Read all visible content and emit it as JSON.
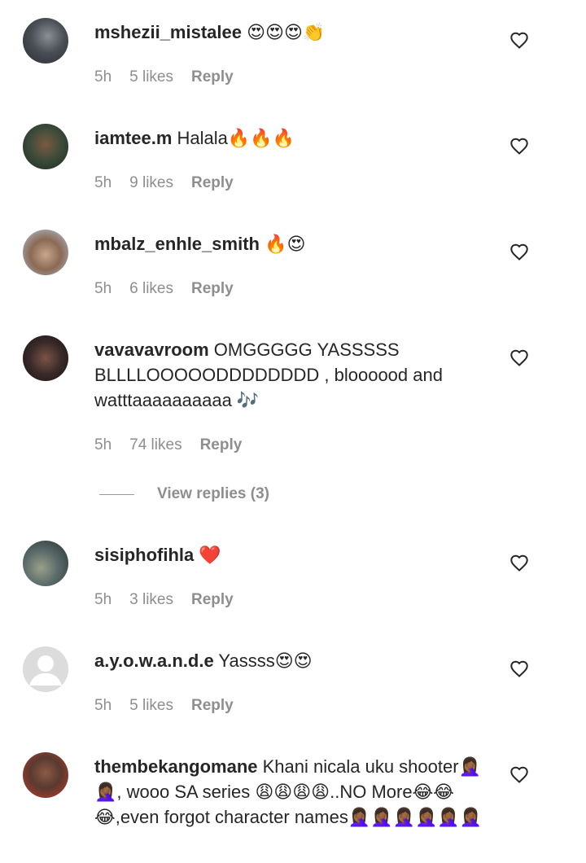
{
  "comments": [
    {
      "username": "mshezii_mistalee",
      "text": " 😍😍😍👏",
      "time": "5h",
      "likes": "5 likes",
      "reply": "Reply",
      "avatar_color": "#4a4e55"
    },
    {
      "username": "iamtee.m",
      "text": " Halala🔥🔥🔥",
      "time": "5h",
      "likes": "9 likes",
      "reply": "Reply",
      "avatar_color": "#3b4a3a"
    },
    {
      "username": "mbalz_enhle_smith",
      "text": " 🔥😍",
      "time": "5h",
      "likes": "6 likes",
      "reply": "Reply",
      "avatar_color": "#c9a58b"
    },
    {
      "username": "vavavavroom",
      "text": " OMGGGGG YASSSSS BLLLLOOOOODDDDDDDD , bloooood and watttaaaaaaaaaa 🎶",
      "time": "5h",
      "likes": "74 likes",
      "reply": "Reply",
      "avatar_color": "#3a2a2a"
    },
    {
      "username": "sisiphofihla",
      "text": " ❤️",
      "time": "5h",
      "likes": "3 likes",
      "reply": "Reply",
      "avatar_color": "#5a6a6a"
    },
    {
      "username": "a.y.o.w.a.n.d.e",
      "text": " Yassss😍😍",
      "time": "5h",
      "likes": "5 likes",
      "reply": "Reply",
      "avatar_color": "#dcdcdc"
    },
    {
      "username": "thembekangomane",
      "text": " Khani nicala uku shooter🤦🏾‍♀️🤦🏾‍♀️, wooo SA series 😩😩😩😩..NO More😂😂😂,even forgot character names🤦🏾‍♀️🤦🏾‍♀️🤦🏾‍♀️🤦🏾‍♀️🤦🏾‍♀️🤦🏾‍♀️",
      "time": "",
      "likes": "",
      "reply": "",
      "avatar_color": "#5a3a30"
    }
  ],
  "view_replies": "View replies (3)"
}
